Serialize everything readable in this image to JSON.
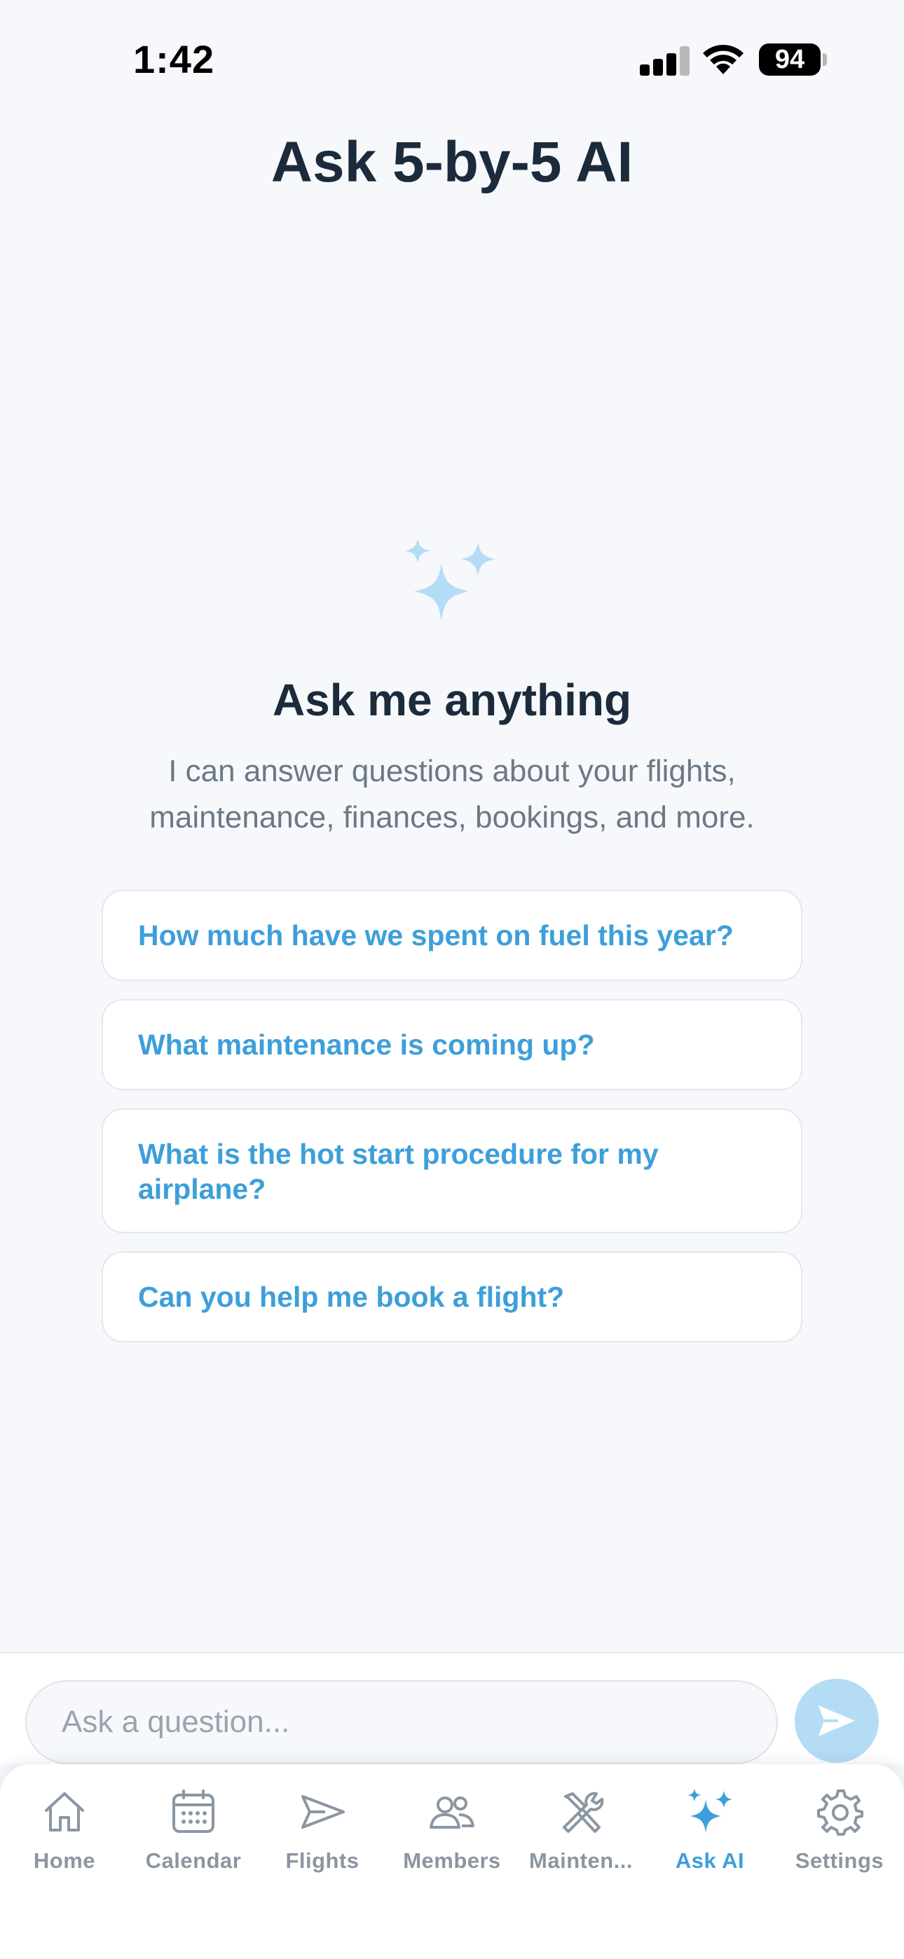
{
  "status_bar": {
    "time": "1:42",
    "battery": "94",
    "icons": [
      "signal-icon",
      "wifi-icon",
      "battery-icon"
    ]
  },
  "header": {
    "title": "Ask 5-by-5 AI"
  },
  "empty_state": {
    "icon": "sparkles-icon",
    "title": "Ask me anything",
    "description": "I can answer questions about your flights, maintenance, finances, bookings, and more."
  },
  "suggestions": [
    "How much have we spent on fuel this year?",
    "What maintenance is coming up?",
    "What is the hot start procedure for my airplane?",
    "Can you help me book a flight?"
  ],
  "input": {
    "placeholder": "Ask a question...",
    "value": ""
  },
  "send_icon": "send-icon",
  "tabs": [
    {
      "label": "Home",
      "icon": "home-icon",
      "active": false
    },
    {
      "label": "Calendar",
      "icon": "calendar-icon",
      "active": false
    },
    {
      "label": "Flights",
      "icon": "paper-plane-icon",
      "active": false
    },
    {
      "label": "Members",
      "icon": "members-icon",
      "active": false
    },
    {
      "label": "Mainten...",
      "icon": "tools-icon",
      "active": false
    },
    {
      "label": "Ask AI",
      "icon": "sparkles-icon",
      "active": true
    },
    {
      "label": "Settings",
      "icon": "gear-icon",
      "active": false
    }
  ],
  "colors": {
    "accent": "#3d9fd9",
    "accent_light": "#b4dcf5",
    "title": "#1c2b3b",
    "muted": "#8b96a2",
    "background": "#f6f8fb"
  }
}
